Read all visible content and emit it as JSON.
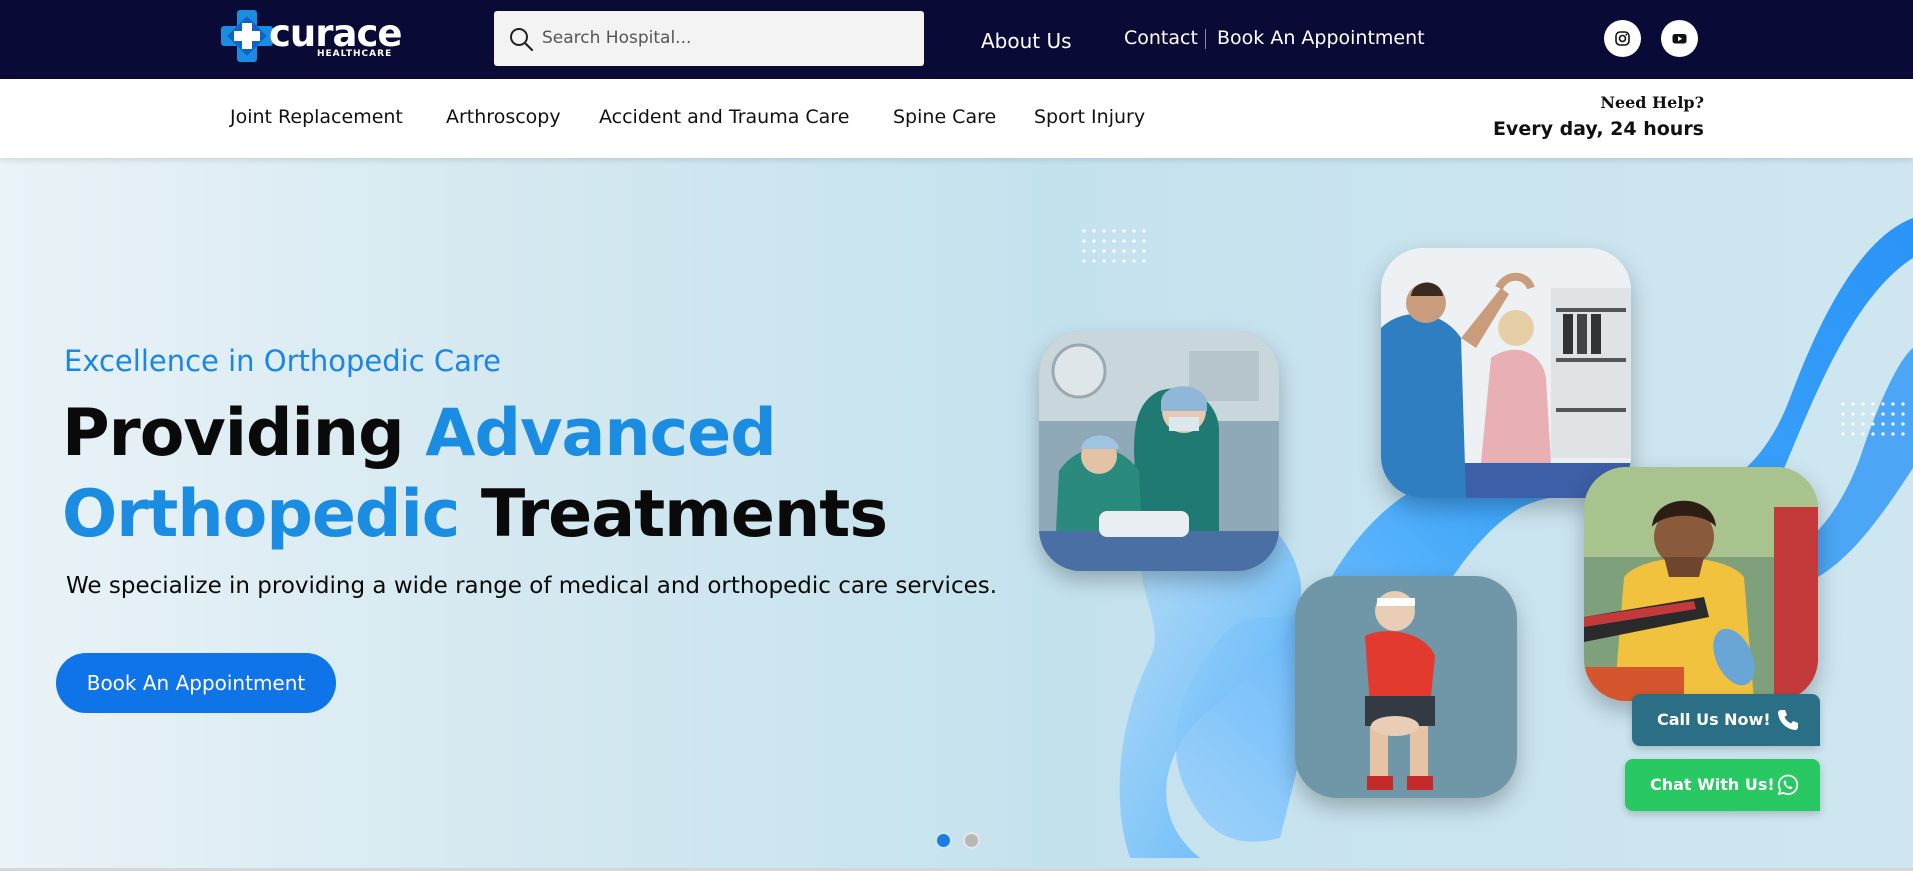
{
  "brand": {
    "name": "curace",
    "tagline": "HEALTHCARE",
    "colors": {
      "navy": "#0a0a36",
      "blue": "#1a8de3",
      "button": "#0f74e8",
      "whatsapp": "#28c862",
      "call": "#2b6f86"
    }
  },
  "search": {
    "placeholder": "Search Hospital...",
    "value": "",
    "icon": "search-icon"
  },
  "top_nav": {
    "about": "About Us",
    "contact": "Contact",
    "book": "Book An Appointment"
  },
  "social": [
    {
      "icon": "instagram-icon"
    },
    {
      "icon": "youtube-icon"
    }
  ],
  "sub_nav": {
    "items": [
      "Joint Replacement",
      "Arthroscopy",
      "Accident and Trauma Care",
      "Spine Care",
      "Sport Injury"
    ],
    "help_label": "Need Help?",
    "help_hours": "Every day, 24 hours"
  },
  "hero": {
    "eyebrow": "Excellence in Orthopedic Care",
    "headline": {
      "part1": "Providing ",
      "part2": "Advanced",
      "part3": "Orthopedic",
      "part4": " Treatments"
    },
    "lead": "We specialize in providing a wide range of medical and orthopedic care services.",
    "cta": "Book An Appointment",
    "slides": {
      "count": 2,
      "active": 1
    }
  },
  "floating": {
    "call": "Call Us Now!",
    "chat": "Chat With Us!",
    "call_icon": "phone-icon",
    "chat_icon": "whatsapp-icon"
  }
}
